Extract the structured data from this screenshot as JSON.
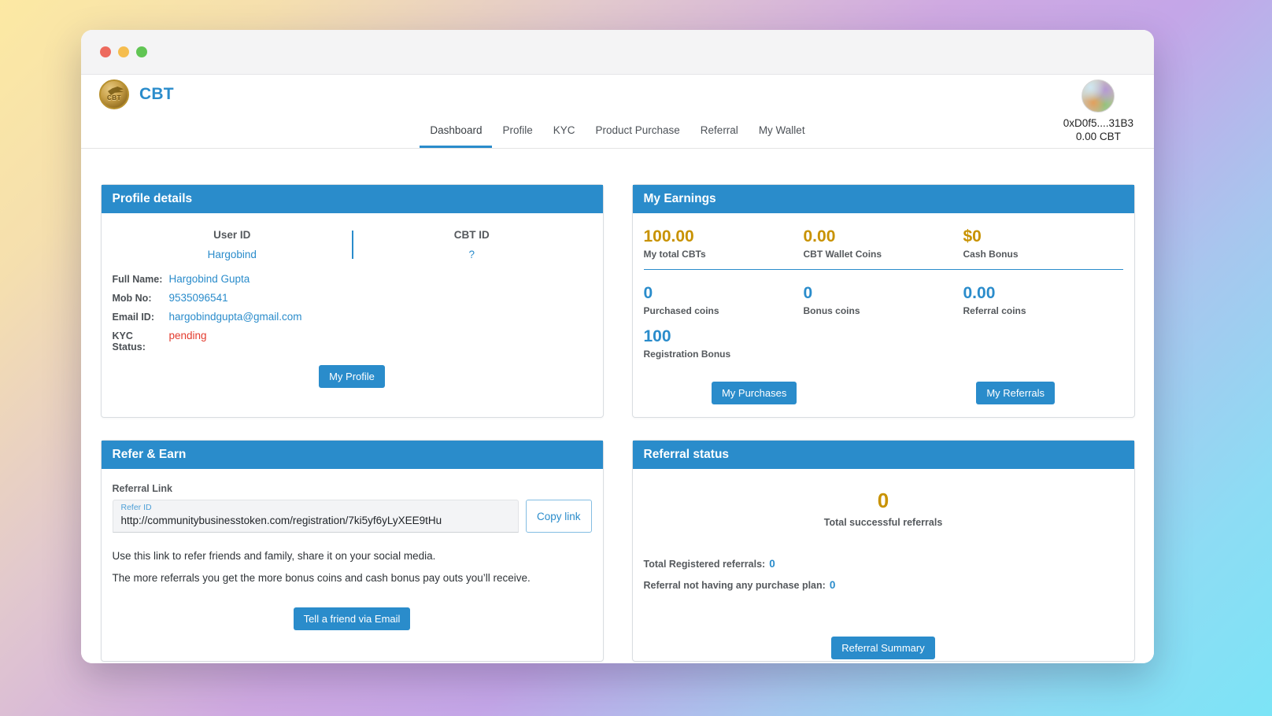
{
  "app": {
    "brand_name": "CBT",
    "logo_text": "CBT"
  },
  "nav": {
    "tabs": [
      {
        "label": "Dashboard",
        "active": true
      },
      {
        "label": "Profile",
        "active": false
      },
      {
        "label": "KYC",
        "active": false
      },
      {
        "label": "Product Purchase",
        "active": false
      },
      {
        "label": "Referral",
        "active": false
      },
      {
        "label": "My Wallet",
        "active": false
      }
    ]
  },
  "account": {
    "address": "0xD0f5....31B3",
    "balance": "0.00 CBT"
  },
  "profile_card": {
    "title": "Profile details",
    "user_id_label": "User ID",
    "user_id_value": "Hargobind",
    "cbt_id_label": "CBT ID",
    "cbt_id_value": "?",
    "fields": [
      {
        "key": "Full Name:",
        "value": "Hargobind Gupta",
        "status": false
      },
      {
        "key": "Mob No:",
        "value": "9535096541",
        "status": false
      },
      {
        "key": "Email ID:",
        "value": "hargobindgupta@gmail.com",
        "status": false
      },
      {
        "key": "KYC Status:",
        "value": "pending",
        "status": true
      }
    ],
    "button": "My Profile"
  },
  "earnings_card": {
    "title": "My Earnings",
    "top_stats": [
      {
        "value": "100.00",
        "label": "My total CBTs"
      },
      {
        "value": "0.00",
        "label": "CBT Wallet Coins"
      },
      {
        "value": "$0",
        "label": "Cash Bonus"
      }
    ],
    "mid_stats": [
      {
        "value": "0",
        "label": "Purchased coins"
      },
      {
        "value": "0",
        "label": "Bonus coins"
      },
      {
        "value": "0.00",
        "label": "Referral coins"
      }
    ],
    "bottom_stats": [
      {
        "value": "100",
        "label": "Registration Bonus"
      }
    ],
    "purchases_button": "My Purchases",
    "referrals_button": "My Referrals"
  },
  "refer_card": {
    "title": "Refer & Earn",
    "field_label": "Referral Link",
    "input_label": "Refer ID",
    "input_value": "http://communitybusinesstoken.com/registration/7ki5yf6yLyXEE9tHu",
    "copy_button": "Copy link",
    "note_1": "Use this link to refer friends and family, share it on your social media.",
    "note_2": "The more referrals you get the more bonus coins and cash bonus pay outs you’ll receive.",
    "email_button": "Tell a friend via Email"
  },
  "status_card": {
    "title": "Referral status",
    "total_value": "0",
    "total_label": "Total successful referrals",
    "lines": [
      {
        "label": "Total Registered referrals:",
        "value": "0"
      },
      {
        "label": "Referral not having any purchase plan:",
        "value": "0"
      }
    ],
    "summary_button": "Referral Summary"
  }
}
